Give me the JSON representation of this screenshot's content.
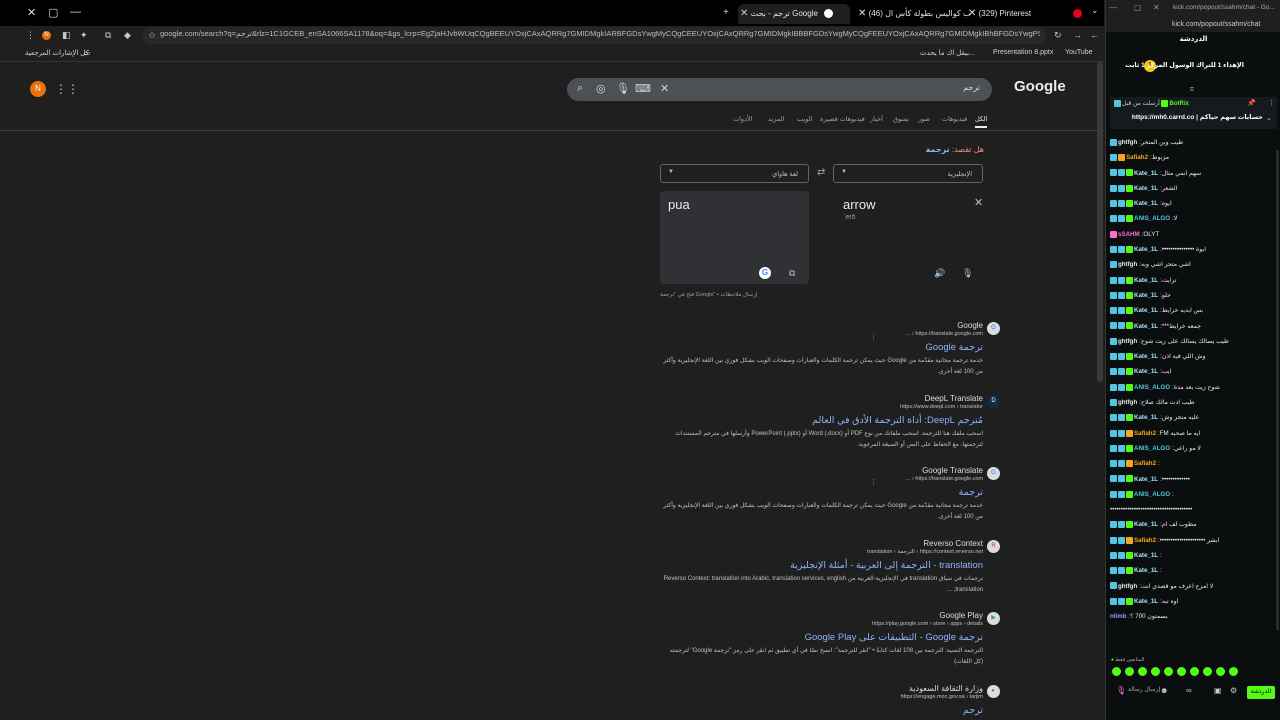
{
  "tabs": [
    {
      "label": "ترجم - بحث Google"
    },
    {
      "label": "(46) طلب كواليس بطولة كأس ال..."
    },
    {
      "label": "(329) Pinterest"
    }
  ],
  "url": "google.com/search?q=ترجم&rlz=1C1GCEB_enSA1066SA1178&oq=&gs_lcrp=EgZjaHJvbWUqCQgBEEUYOxjCAxAQRRg7GMIDMgkIARBFGDsYwgMyCQgCEEUYOxjCAxQRRg7GMIDMgkIBBBFGDsYwgMyCQgFEEUYOxjCAxAQRRg7GMIDMgkIBhBFGDsYwgPSAQ4OTVqMGo...",
  "bookmarks": [
    {
      "label": "YouTube"
    },
    {
      "label": "Presentation 8.pptx"
    },
    {
      "label": "بيقل اك ما يحدث..."
    },
    {
      "label": "كل الإشارات المرجعية"
    }
  ],
  "google": {
    "logo": "Google",
    "query": "ترجم",
    "avatar": "N",
    "tabs": [
      "الكل",
      "فيديوهات",
      "صور",
      "تسوق",
      "أخبار",
      "فيديوهات قصيرة",
      "الويب",
      "المزيد",
      "الأدوات"
    ],
    "did_you_mean": "هل تقصد:",
    "suggestion": "ترجمة"
  },
  "translate": {
    "source_lang": "الإنجليزية",
    "target_lang": "لغة هاواي",
    "source_text": "arrow",
    "romanization": "ˈerō",
    "output_text": "pua",
    "footer": "فتح في \"ترجمة Google\" • إرسال ملاحظات"
  },
  "results": [
    {
      "site": "Google",
      "cite": "https://translate.google.com ‹ ...",
      "title": "ترجمة Google",
      "snippet": "خدمة ترجمة مجانية مقدّمة من Google حيث يمكن ترجمة الكلمات والعبارات وصفحات الويب بشكل فوري بين اللغة الإنجليزية وأكثر من 100 لغة أخرى.",
      "fav": "G"
    },
    {
      "site": "DeepL Translate",
      "cite": "https://www.deepl.com › translator",
      "title": "مُترجم DeepL: أداة الترجمة الأدق في العالم",
      "snippet": "اسحب ملفك هنا للترجمة. اسحب ملفاتك من نوع PDF أو Word (.docx) أو PowerPoint (.pptx) وأرسلها في مترجم المستندات لترجمتها، مع الحفاظ على النص أو الصيغة المرغوبة.",
      "fav": "D"
    },
    {
      "site": "Google Translate",
      "cite": "https://translate.google.com ‹ ...",
      "title": "ترجمة",
      "snippet": "خدمة ترجمة مجانية مقدّمة من Google حيث يمكن ترجمة الكلمات والعبارات وصفحات الويب بشكل فوري بين اللغة الإنجليزية وأكثر من 100 لغة أخرى.",
      "fav": "G"
    },
    {
      "site": "Reverso Context",
      "cite": "https://context.reverso.net › الترجمة › translation",
      "title": "translation - الترجمة إلى العربية - أمثلة الإنجليزية",
      "snippet": "ترجمات في سياق translation في الإنجليزية-العربية من Reverso Context: translation into Arabic, translation services, english translation, ...",
      "fav": "R"
    },
    {
      "site": "Google Play",
      "cite": "https://play.google.com › store › apps › details",
      "title": "ترجمة Google - التطبيقات على Google Play",
      "snippet": "الترجمة النصية: الترجمة بين 108 لغات كتابةً • \"انقر للترجمة\": انسخ نصًا في أي تطبيق ثم انقر على رمز \"ترجمة Google\" لترجمته (كل اللغات)",
      "fav": "▶"
    },
    {
      "site": "وزارة الثقافة السعودية",
      "cite": "https://engage.moc.gov.sa › tarjim",
      "title": "ترجم",
      "snippet": "",
      "fav": "◐"
    }
  ],
  "chat": {
    "url": "kick.com/popout/ssahm/chat",
    "window_title": "kick.com/popout/ssahm/chat - Go...",
    "header": "الدردشة",
    "pinned": "الإهداء 1 للتراك الوسول المركز 1 ثابت",
    "bot_user": "BotRix",
    "bot_note": "أرسلت من قبل",
    "bot_text": "حسابات سهم حياكم | https://mh0.carrd.co",
    "messages": [
      {
        "user": "ghtfgh",
        "text": "طيب وين المتجر",
        "badges": [
          "blue"
        ]
      },
      {
        "user": "Safiah2",
        "text": "مزبوط",
        "badges": [
          "blue",
          "gold"
        ]
      },
      {
        "user": "Kate_1L",
        "text": "سهم انمي متال",
        "badges": [
          "blue",
          "blue",
          "green"
        ]
      },
      {
        "user": "Kate_1L",
        "text": "الشعر",
        "badges": [
          "blue",
          "blue",
          "green"
        ]
      },
      {
        "user": "Kate_1L",
        "text": "ايوه",
        "badges": [
          "blue",
          "blue",
          "green"
        ]
      },
      {
        "user": "ANIS_ALGO",
        "text": "لا",
        "badges": [
          "blue",
          "blue",
          "green"
        ]
      },
      {
        "user": "sSAHM",
        "text": "OLYT",
        "badges": [
          "pink"
        ]
      },
      {
        "user": "Kate_1L",
        "text": "••••••••••••••• ايوة",
        "badges": [
          "blue",
          "blue",
          "green"
        ]
      },
      {
        "user": "ghtfgh",
        "text": "اشي متجر اشي وبه",
        "badges": [
          "blue"
        ]
      },
      {
        "user": "Kate_1L",
        "text": "ترايت",
        "badges": [
          "blue",
          "blue",
          "green"
        ]
      },
      {
        "user": "Kate_1L",
        "text": "حلو",
        "badges": [
          "blue",
          "blue",
          "green"
        ]
      },
      {
        "user": "Kate_1L",
        "text": "بس ابديه خرايط",
        "badges": [
          "blue",
          "blue",
          "green"
        ]
      },
      {
        "user": "Kate_1L",
        "text": "***جمعه خرايط",
        "badges": [
          "blue",
          "blue",
          "green"
        ]
      },
      {
        "user": "ghtfgh",
        "text": "طيب يسالك يسالك على زيت شوح",
        "badges": [
          "blue"
        ]
      },
      {
        "user": "Kate_1L",
        "text": "وش اللي فيه اذن",
        "badges": [
          "blue",
          "blue",
          "green"
        ]
      },
      {
        "user": "Kate_1L",
        "text": "ايب",
        "badges": [
          "blue",
          "blue",
          "green"
        ]
      },
      {
        "user": "ANIS_ALGO",
        "text": "شوح زيت بعد مدة",
        "badges": [
          "blue",
          "blue",
          "green"
        ]
      },
      {
        "user": "ghtfgh",
        "text": "طيب ادت مالك صلاح",
        "badges": [
          "blue"
        ]
      },
      {
        "user": "Kate_1L",
        "text": "عليه متجر وش",
        "badges": [
          "blue",
          "blue",
          "green"
        ]
      },
      {
        "user": "Safiah2",
        "text": "FM ايه ما صحيه",
        "badges": [
          "blue",
          "blue",
          "gold"
        ]
      },
      {
        "user": "ANIS_ALGO",
        "text": "لا مو راعي",
        "badges": [
          "blue",
          "blue",
          "green"
        ]
      },
      {
        "user": "Safiah2",
        "text": "",
        "badges": [
          "blue",
          "blue",
          "gold"
        ]
      },
      {
        "user": "Kate_1L",
        "text": "•••••••••••••",
        "badges": [
          "blue",
          "blue",
          "green"
        ]
      },
      {
        "user": "ANIS_ALGO",
        "text": "",
        "badges": [
          "blue",
          "blue",
          "green"
        ]
      },
      {
        "user": "",
        "text": "••••••••••••••••••••••••••••••••••••••",
        "badges": []
      },
      {
        "user": "Kate_1L",
        "text": "مطوب لف ام",
        "badges": [
          "blue",
          "blue",
          "green"
        ]
      },
      {
        "user": "Safiah2",
        "text": "••••••••••••••••••••• ابشر",
        "badges": [
          "blue",
          "blue",
          "gold"
        ]
      },
      {
        "user": "Kate_1L",
        "text": "",
        "badges": [
          "blue",
          "blue",
          "green"
        ]
      },
      {
        "user": "Kate_1L",
        "text": "",
        "badges": [
          "blue",
          "blue",
          "green"
        ]
      },
      {
        "user": "ghtfgh",
        "text": "لا امزح اعرف مو قصدي انت",
        "badges": [
          "blue"
        ]
      },
      {
        "user": "Kate_1L",
        "text": "اوه تبه",
        "badges": [
          "blue",
          "blue",
          "green"
        ]
      },
      {
        "user": "nlimb",
        "text": "بسمتون 700 ؟",
        "badges": []
      }
    ],
    "input_placeholder": "إرسال رسالة",
    "send_label": "الدردشة",
    "viewer_label": "المتابعين فقط"
  }
}
